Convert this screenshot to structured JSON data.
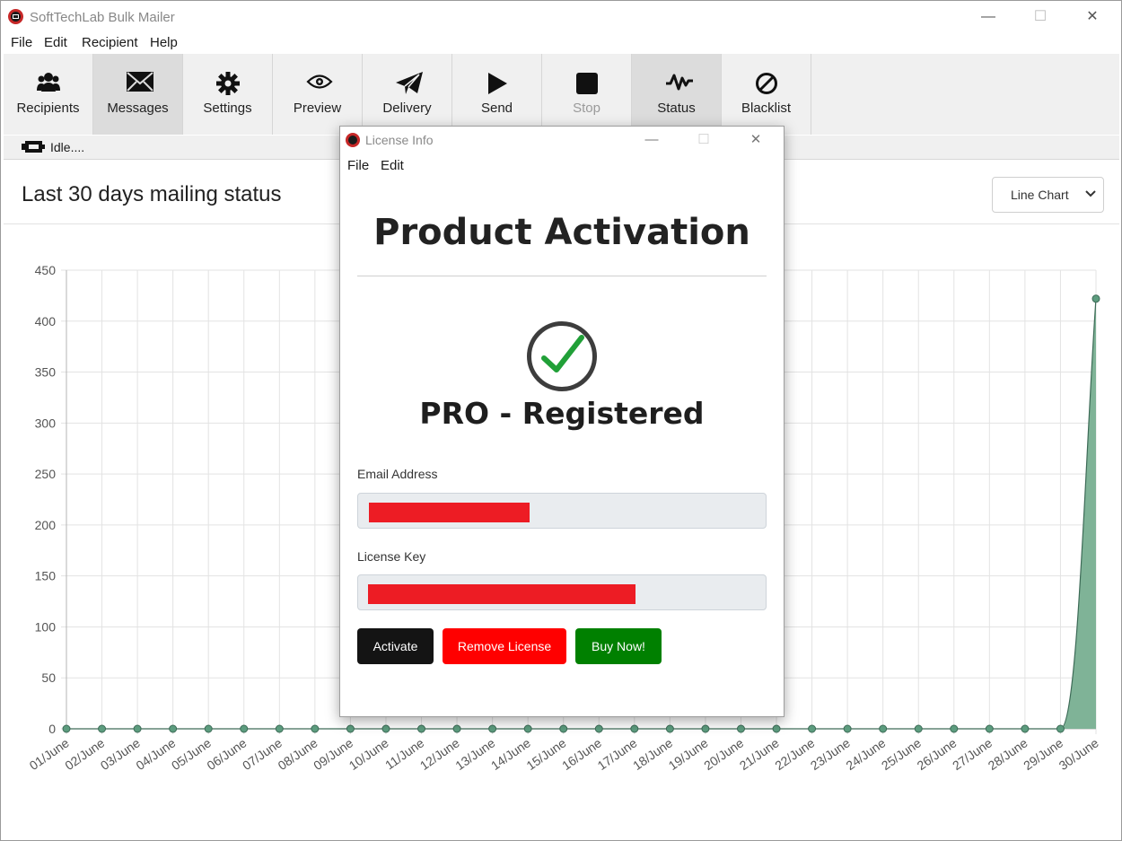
{
  "app": {
    "title": "SoftTechLab Bulk Mailer"
  },
  "menu": [
    "File",
    "Edit",
    "Recipient",
    "Help"
  ],
  "toolbar": [
    {
      "label": "Recipients",
      "icon": "users-icon"
    },
    {
      "label": "Messages",
      "icon": "envelope-icon"
    },
    {
      "label": "Settings",
      "icon": "gear-icon"
    },
    {
      "label": "Preview",
      "icon": "eye-icon"
    },
    {
      "label": "Delivery",
      "icon": "paper-plane-icon"
    },
    {
      "label": "Send",
      "icon": "play-icon"
    },
    {
      "label": "Stop",
      "icon": "stop-icon"
    },
    {
      "label": "Status",
      "icon": "pulse-icon"
    },
    {
      "label": "Blacklist",
      "icon": "ban-icon"
    }
  ],
  "status": {
    "text": "Idle...."
  },
  "dashboard": {
    "heading": "Last 30 days mailing status",
    "chart_type_select": "Line Chart"
  },
  "chart_data": {
    "type": "area",
    "title": "",
    "categories": [
      "01/June",
      "02/June",
      "03/June",
      "04/June",
      "05/June",
      "06/June",
      "07/June",
      "08/June",
      "09/June",
      "10/June",
      "11/June",
      "12/June",
      "13/June",
      "14/June",
      "15/June",
      "16/June",
      "17/June",
      "18/June",
      "19/June",
      "20/June",
      "21/June",
      "22/June",
      "23/June",
      "24/June",
      "25/June",
      "26/June",
      "27/June",
      "28/June",
      "29/June",
      "30/June"
    ],
    "values": [
      0,
      0,
      0,
      0,
      0,
      0,
      0,
      0,
      0,
      0,
      0,
      0,
      0,
      0,
      0,
      0,
      0,
      0,
      0,
      0,
      0,
      0,
      0,
      0,
      0,
      0,
      0,
      0,
      0,
      422
    ],
    "ylim": [
      0,
      450
    ],
    "yticks": [
      0,
      50,
      100,
      150,
      200,
      250,
      300,
      350,
      400,
      450
    ],
    "grid": true,
    "colors": {
      "fill": "#7fb397",
      "line": "#3d6b57",
      "point": "#5c9c7e"
    }
  },
  "dialog": {
    "title": "License Info",
    "menu": [
      "File",
      "Edit"
    ],
    "heading": "Product Activation",
    "status": "PRO - Registered",
    "email_label": "Email Address",
    "license_label": "License Key",
    "buttons": {
      "activate": "Activate",
      "remove": "Remove License",
      "buy": "Buy Now!"
    }
  }
}
